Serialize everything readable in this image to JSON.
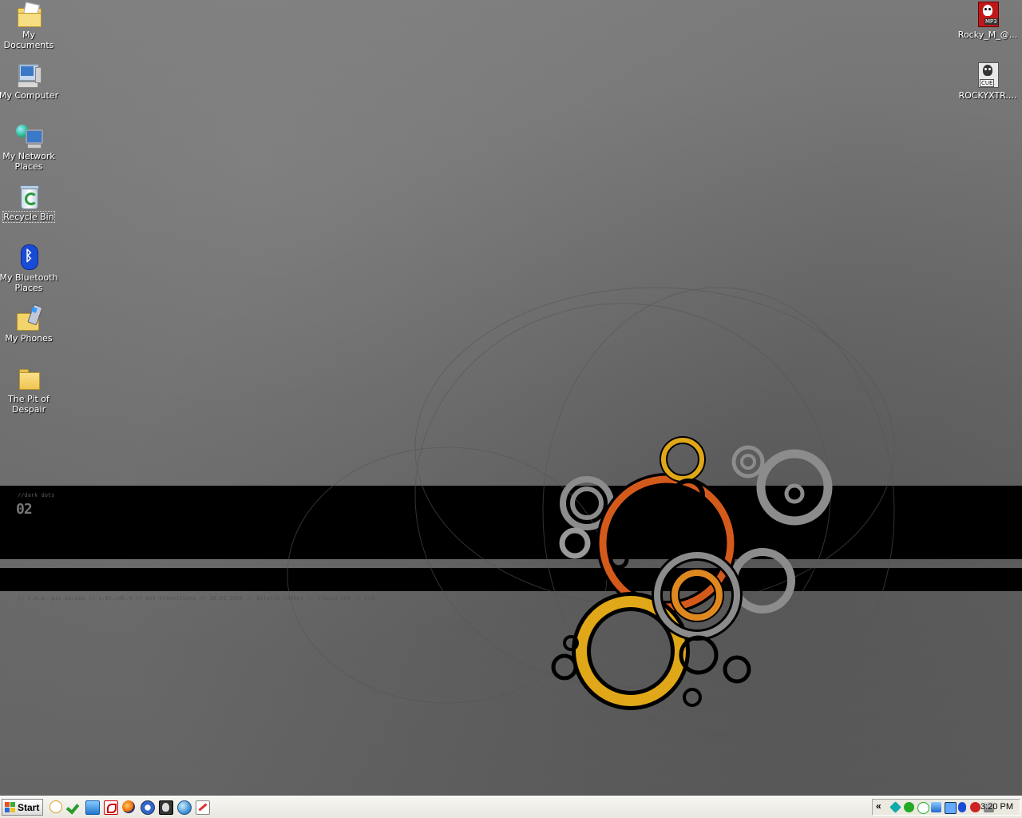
{
  "desktop_icons_left": [
    {
      "label": "My Documents",
      "icon": "my-documents-icon"
    },
    {
      "label": "My Computer",
      "icon": "my-computer-icon"
    },
    {
      "label": "My Network Places",
      "icon": "network-places-icon"
    },
    {
      "label": "Recycle Bin",
      "icon": "recycle-bin-icon"
    },
    {
      "label": "My Bluetooth Places",
      "icon": "bluetooth-icon"
    },
    {
      "label": "My Phones",
      "icon": "phones-folder-icon"
    },
    {
      "label": "The Pit of Despair",
      "icon": "folder-icon"
    }
  ],
  "desktop_icons_right": [
    {
      "label": "Rocky_M_@...",
      "icon": "mp3-file-icon",
      "badge": "MP3"
    },
    {
      "label": "ROCKYXTR....",
      "icon": "cue-file-icon",
      "badge": "CUE"
    }
  ],
  "wallpaper": {
    "tag": "//dark dots",
    "number": "02",
    "credit": "// r.d.b. pic series // v.01.rdb.4 // dot transitions // 10.03.2006 // bolorin toshev // llbood.net // end."
  },
  "taskbar": {
    "start_label": "Start",
    "quick_launch": [
      "clock-icon",
      "checkmark-icon",
      "ie-icon",
      "pdf-icon",
      "firefox-icon",
      "m-icon",
      "alien-icon",
      "globe-icon",
      "paint-icon"
    ],
    "tray": {
      "chevron": "«",
      "icons": [
        "tray-icon-1",
        "tray-icon-2",
        "tray-icon-3",
        "tray-icon-4",
        "tray-icon-5",
        "bluetooth-tray-icon",
        "tray-icon-7",
        "network-tray-icon"
      ],
      "clock": "3:20 PM"
    }
  },
  "colors": {
    "wallpaper_band": "#000000",
    "ring_orange": "#d45a1c",
    "ring_yellow": "#e0a818",
    "ring_amber": "#e08820",
    "ring_gray": "#8c8c8c"
  }
}
